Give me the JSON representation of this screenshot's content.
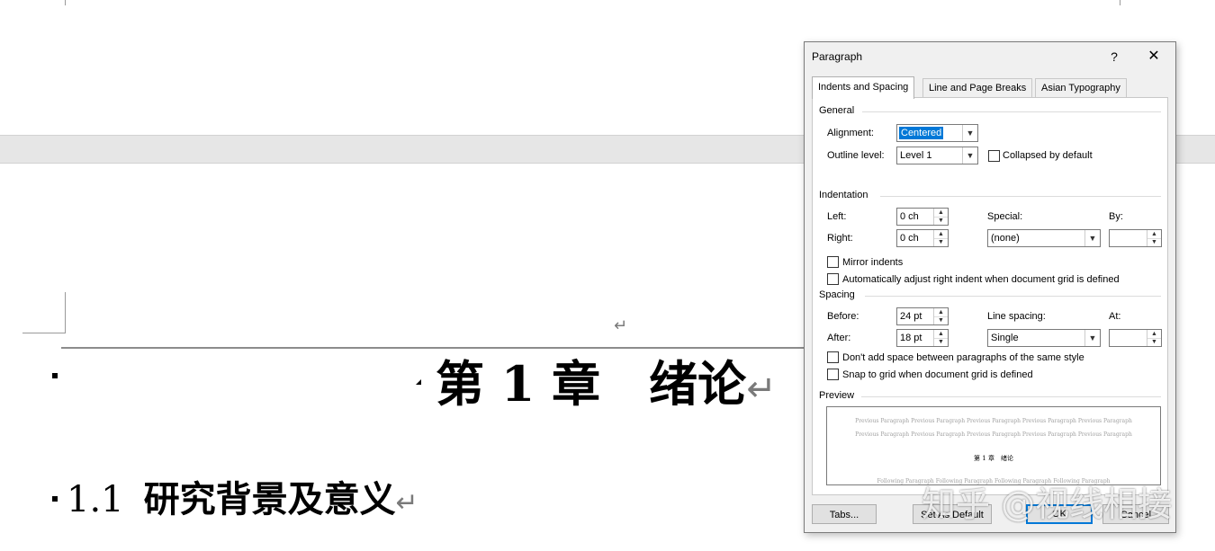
{
  "document": {
    "paragraph_mark": "↵",
    "heading1": "第 1 章　绪论",
    "heading2_number": "1.1",
    "heading2_text": "研究背景及意义"
  },
  "dialog": {
    "title": "Paragraph",
    "help_label": "?",
    "close_label": "✕",
    "tabs": [
      "Indents and Spacing",
      "Line and Page Breaks",
      "Asian Typography"
    ],
    "active_tab": 0,
    "general": {
      "section_label": "General",
      "alignment_label": "Alignment:",
      "alignment_value": "Centered",
      "outline_label": "Outline level:",
      "outline_value": "Level 1",
      "collapsed_label": "Collapsed by default",
      "collapsed_checked": false
    },
    "indentation": {
      "section_label": "Indentation",
      "left_label": "Left:",
      "left_value": "0 ch",
      "right_label": "Right:",
      "right_value": "0 ch",
      "special_label": "Special:",
      "special_value": "(none)",
      "by_label": "By:",
      "by_value": "",
      "mirror_label": "Mirror indents",
      "mirror_checked": false,
      "auto_adjust_label": "Automatically adjust right indent when document grid is defined",
      "auto_adjust_checked": false
    },
    "spacing": {
      "section_label": "Spacing",
      "before_label": "Before:",
      "before_value": "24 pt",
      "after_label": "After:",
      "after_value": "18 pt",
      "line_spacing_label": "Line spacing:",
      "line_spacing_value": "Single",
      "at_label": "At:",
      "at_value": "",
      "dont_add_label": "Don't add space between paragraphs of the same style",
      "dont_add_checked": false,
      "snap_label": "Snap to grid when document grid is defined",
      "snap_checked": false
    },
    "preview": {
      "section_label": "Preview",
      "previous_line_1": "Previous Paragraph Previous Paragraph Previous Paragraph Previous Paragraph Previous Paragraph",
      "previous_line_2": "Previous Paragraph Previous Paragraph Previous Paragraph Previous Paragraph Previous Paragraph",
      "current_text": "第 1 章　绪论",
      "following_line": "Following Paragraph Following Paragraph Following Paragraph Following Paragraph"
    },
    "buttons": {
      "tabs": "Tabs...",
      "set_default": "Set As Default",
      "ok": "OK",
      "cancel": "Cancel"
    }
  },
  "watermark": "知乎 @视线相接",
  "colors": {
    "selection": "#0078d7",
    "dialog_bg": "#f0f0f0",
    "page_gap": "#e6e6e6"
  }
}
